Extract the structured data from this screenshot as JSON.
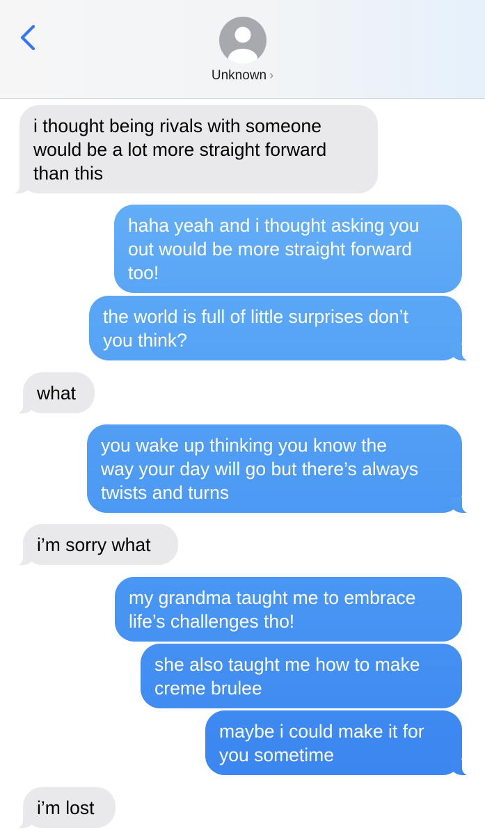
{
  "header": {
    "contact_name": "Unknown",
    "chevron": "›",
    "back_icon": "chevron-left-icon",
    "avatar_icon": "person-silhouette-icon"
  },
  "colors": {
    "accent": "#3478f6",
    "incoming_bubble": "#e9e9eb",
    "outgoing_top": "#5eaaf6",
    "outgoing_bottom": "#3d86f0"
  },
  "messages": [
    {
      "direction": "incoming",
      "lines": [
        "i thought being rivals with someone",
        "would be a lot more straight forward",
        "than this"
      ]
    },
    {
      "direction": "outgoing",
      "lines": [
        "haha yeah and i thought asking you",
        "out would be more straight forward",
        "too!"
      ]
    },
    {
      "direction": "outgoing",
      "lines": [
        "the world is full of little surprises don’t",
        "you think?"
      ]
    },
    {
      "direction": "incoming",
      "lines": [
        "what"
      ]
    },
    {
      "direction": "outgoing",
      "lines": [
        "you wake up thinking you know the",
        "way your day will go but there’s always",
        "twists and turns"
      ]
    },
    {
      "direction": "incoming",
      "lines": [
        "i’m sorry what"
      ]
    },
    {
      "direction": "outgoing",
      "lines": [
        "my grandma taught me to embrace",
        "life’s challenges tho!"
      ]
    },
    {
      "direction": "outgoing",
      "lines": [
        "she also taught me how to make",
        "creme brulee"
      ]
    },
    {
      "direction": "outgoing",
      "lines": [
        "maybe i could make it for",
        "you sometime"
      ]
    },
    {
      "direction": "incoming",
      "lines": [
        "i’m lost"
      ]
    }
  ]
}
